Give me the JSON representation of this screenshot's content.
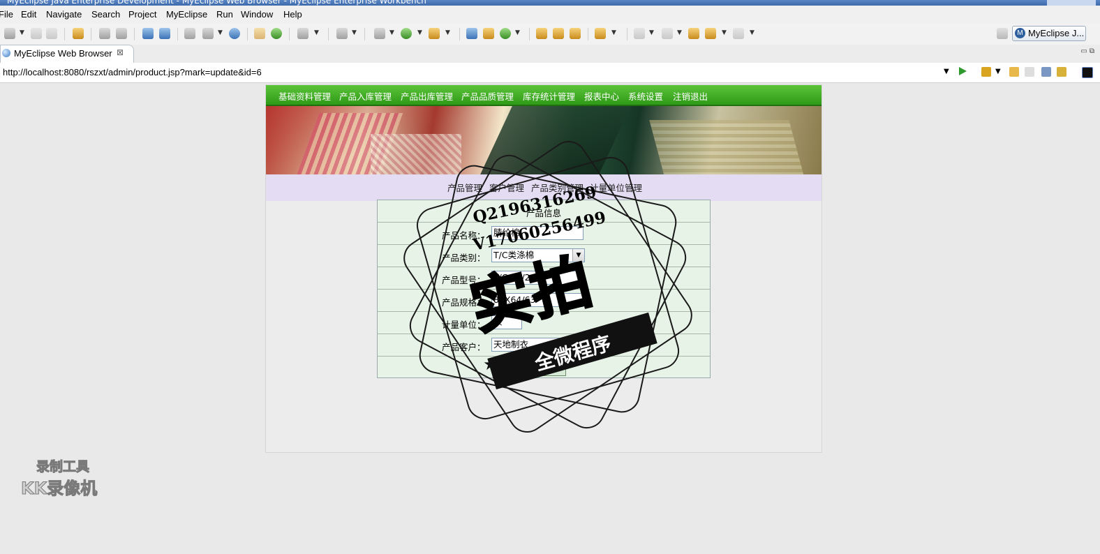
{
  "window": {
    "title": "MyEclipse Java Enterprise Development - MyEclipse Web Browser - MyEclipse Enterprise Workbench"
  },
  "menu": [
    "File",
    "Edit",
    "Navigate",
    "Search",
    "Project",
    "MyEclipse",
    "Run",
    "Window",
    "Help"
  ],
  "perspective": {
    "icon": "M",
    "label": "MyEclipse J..."
  },
  "editor_tab": {
    "label": "MyEclipse Web Browser",
    "close": "⊠"
  },
  "browser": {
    "url": "http://localhost:8080/rszxt/admin/product.jsp?mark=update&id=6"
  },
  "site": {
    "nav": [
      "基础资料管理",
      "产品入库管理",
      "产品出库管理",
      "产品品质管理",
      "库存统计管理",
      "报表中心",
      "系统设置",
      "注销退出"
    ],
    "subnav": [
      "产品管理",
      "客户管理",
      "产品类别管理",
      "计量单位管理"
    ]
  },
  "form": {
    "title": "产品信息",
    "fields": [
      {
        "label": "产品名称：",
        "value": "腈纶棉"
      },
      {
        "label": "产品类别：",
        "value": "T/C类涤棉"
      },
      {
        "label": "产品型号：",
        "value": "T/C 40/2"
      },
      {
        "label": "产品规格：",
        "value": "88X64/63"
      },
      {
        "label": "计量单位：",
        "value": "米"
      },
      {
        "label": "产品客户：",
        "value": "天地制衣"
      }
    ],
    "submit": "修改"
  },
  "overlays": {
    "stamp": {
      "qq": "Q2196316269",
      "vx": "V17060256499",
      "main": "实拍",
      "ribbon": "全微程序"
    },
    "recorder": {
      "line1": "录制工具",
      "line2": "KK录像机"
    }
  }
}
